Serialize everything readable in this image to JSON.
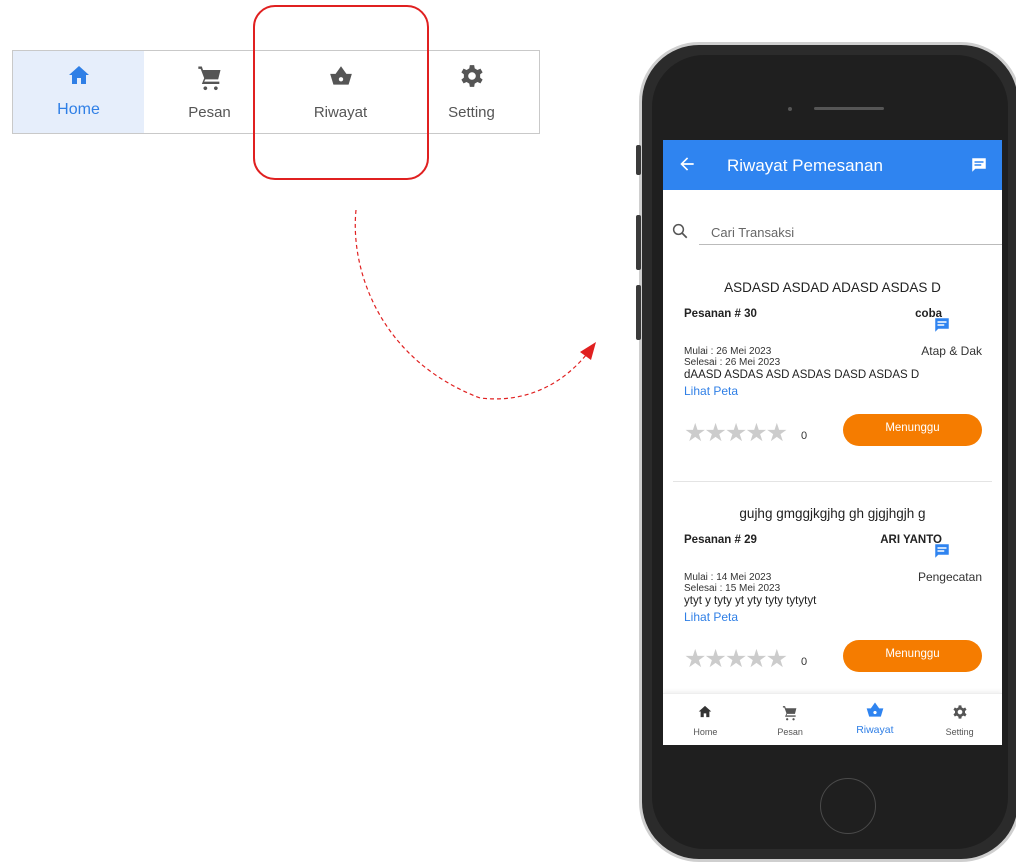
{
  "nav": {
    "items": [
      {
        "label": "Home",
        "icon": "home-icon"
      },
      {
        "label": "Pesan",
        "icon": "cart-icon"
      },
      {
        "label": "Riwayat",
        "icon": "basket-icon"
      },
      {
        "label": "Setting",
        "icon": "gear-icon"
      }
    ]
  },
  "colors": {
    "accent": "#2f84f0",
    "status": "#f57c00",
    "highlight": "#e02020",
    "activeNavBg": "#e6eefb"
  },
  "app": {
    "title": "Riwayat Pemesanan",
    "search_placeholder": "Cari Transaksi"
  },
  "orders": [
    {
      "title": "ASDASD ASDAD ADASD ASDAS D",
      "number": "Pesanan # 30",
      "customer": "coba",
      "start": "Mulai : 26 Mei 2023",
      "end": "Selesai : 26 Mei 2023",
      "service": "Atap & Dak",
      "description": "dAASD ASDAS ASD ASDAS DASD ASDAS D",
      "map_link": "Lihat Peta",
      "stars": "★★★★★",
      "rating": "0",
      "status": "Menunggu"
    },
    {
      "title": "gujhg gmggjkgjhg gh gjgjhgjh g",
      "number": "Pesanan # 29",
      "customer": "ARI YANTO",
      "start": "Mulai : 14 Mei 2023",
      "end": "Selesai : 15 Mei 2023",
      "service": "Pengecatan",
      "description": "ytyt y tyty yt yty tyty tytytyt",
      "map_link": "Lihat Peta",
      "stars": "★★★★★",
      "rating": "0",
      "status": "Menunggu"
    }
  ]
}
